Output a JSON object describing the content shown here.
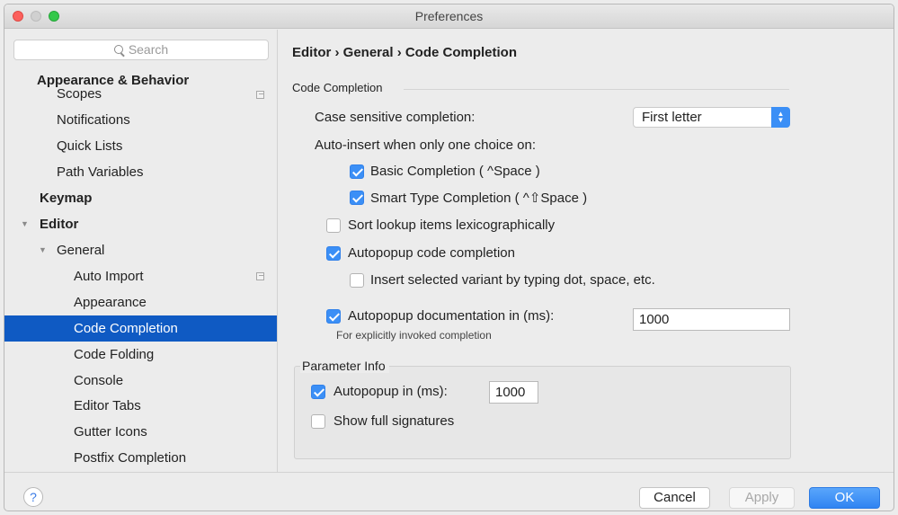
{
  "window": {
    "title": "Preferences"
  },
  "sidebar": {
    "search_placeholder": "Search",
    "group_header": "Appearance & Behavior",
    "scopes": "Scopes",
    "items": [
      {
        "label": "Notifications"
      },
      {
        "label": "Quick Lists"
      },
      {
        "label": "Path Variables"
      },
      {
        "label": "Keymap"
      },
      {
        "label": "Editor"
      },
      {
        "label": "General"
      },
      {
        "label": "Auto Import"
      },
      {
        "label": "Appearance"
      },
      {
        "label": "Code Completion"
      },
      {
        "label": "Code Folding"
      },
      {
        "label": "Console"
      },
      {
        "label": "Editor Tabs"
      },
      {
        "label": "Gutter Icons"
      },
      {
        "label": "Postfix Completion"
      }
    ],
    "selected": "Code Completion"
  },
  "main": {
    "breadcrumb": "Editor › General › Code Completion",
    "section_title": "Code Completion",
    "case_sensitive": {
      "label": "Case sensitive completion:",
      "value": "First letter"
    },
    "auto_insert_label": "Auto-insert when only one choice on:",
    "basic_completion": {
      "label": "Basic Completion ( ^Space )",
      "checked": true
    },
    "smart_completion": {
      "label": "Smart Type Completion ( ^⇧Space )",
      "checked": true
    },
    "sort_lookup": {
      "label": "Sort lookup items lexicographically",
      "checked": false
    },
    "autopopup_completion": {
      "label": "Autopopup code completion",
      "checked": true
    },
    "insert_variant": {
      "label": "Insert selected variant by typing dot, space, etc.",
      "checked": false
    },
    "autopopup_docs": {
      "label": "Autopopup documentation in (ms):",
      "checked": true,
      "value": "1000"
    },
    "docs_hint": "For explicitly invoked completion",
    "parameter_info": {
      "title": "Parameter Info",
      "autopopup": {
        "label": "Autopopup in (ms):",
        "checked": true,
        "value": "1000"
      },
      "full_signatures": {
        "label": "Show full signatures",
        "checked": false
      }
    }
  },
  "footer": {
    "help": "?",
    "cancel": "Cancel",
    "apply": "Apply",
    "ok": "OK"
  },
  "colors": {
    "selection": "#0f5ac3",
    "accent": "#3b8ff6"
  }
}
